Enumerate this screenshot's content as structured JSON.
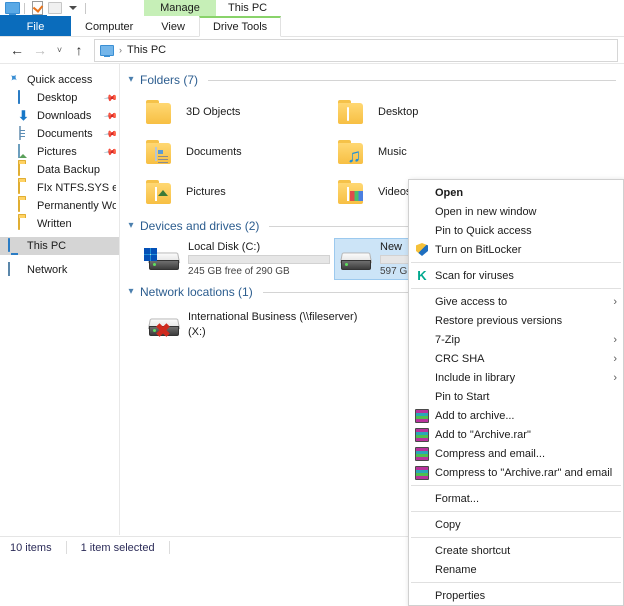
{
  "window": {
    "title": "This PC",
    "contextual_tab_header": "Manage",
    "quick_access_toolbar": [
      {
        "icon": "monitor-icon",
        "name": "this-pc-icon"
      },
      {
        "icon": "properties-icon",
        "name": "properties-icon"
      },
      {
        "icon": "new-folder-icon",
        "name": "new-folder-icon"
      },
      {
        "icon": "chevron-down-icon",
        "name": "customize-qat-icon"
      }
    ]
  },
  "ribbon": {
    "tabs": [
      {
        "label": "File",
        "state": "file"
      },
      {
        "label": "Computer",
        "state": "normal"
      },
      {
        "label": "View",
        "state": "normal"
      },
      {
        "label": "Drive Tools",
        "state": "active"
      }
    ]
  },
  "address_bar": {
    "back": "←",
    "forward": "→",
    "recent": "˅",
    "up": "↑",
    "separator": "›",
    "path": "This PC"
  },
  "sidebar": {
    "items": [
      {
        "label": "Quick access",
        "icon": "pin-star-icon",
        "indent": false,
        "pinned": false,
        "selected": false
      },
      {
        "label": "Desktop",
        "icon": "desktop-icon",
        "indent": true,
        "pinned": true,
        "selected": false
      },
      {
        "label": "Downloads",
        "icon": "downloads-icon",
        "indent": true,
        "pinned": true,
        "selected": false
      },
      {
        "label": "Documents",
        "icon": "documents-icon",
        "indent": true,
        "pinned": true,
        "selected": false
      },
      {
        "label": "Pictures",
        "icon": "pictures-icon",
        "indent": true,
        "pinned": true,
        "selected": false
      },
      {
        "label": "Data Backup",
        "icon": "folder-icon",
        "indent": true,
        "pinned": false,
        "selected": false
      },
      {
        "label": "FIx NTFS.SYS error",
        "icon": "folder-icon",
        "indent": true,
        "pinned": false,
        "selected": false
      },
      {
        "label": "Permanently Word",
        "icon": "folder-icon",
        "indent": true,
        "pinned": false,
        "selected": false
      },
      {
        "label": "Written",
        "icon": "folder-icon",
        "indent": true,
        "pinned": false,
        "selected": false
      },
      {
        "label": "This PC",
        "icon": "this-pc-icon",
        "indent": false,
        "pinned": false,
        "selected": true
      },
      {
        "label": "Network",
        "icon": "network-icon",
        "indent": false,
        "pinned": false,
        "selected": false
      }
    ]
  },
  "content": {
    "groups": {
      "folders": {
        "title": "Folders (7)",
        "items": [
          {
            "label": "3D Objects",
            "overlay": "3d-object-icon"
          },
          {
            "label": "Desktop",
            "overlay": "desktop-overlay-icon"
          },
          {
            "label": "Documents",
            "overlay": "documents-overlay-icon"
          },
          {
            "label": "Music",
            "overlay": "music-note-icon"
          },
          {
            "label": "Pictures",
            "overlay": "pictures-overlay-icon"
          },
          {
            "label": "Videos",
            "overlay": "videos-overlay-icon"
          }
        ]
      },
      "devices": {
        "title": "Devices and drives (2)",
        "items": [
          {
            "name": "Local Disk (C:)",
            "free_text": "245 GB free of 290 GB",
            "used_percent": 16,
            "selected": false,
            "icon": "local-disk-icon"
          },
          {
            "name": "New",
            "free_text": "597 G",
            "used_percent": 36,
            "selected": true,
            "icon": "drive-icon"
          }
        ]
      },
      "network": {
        "title": "Network locations (1)",
        "items": [
          {
            "label_line1": "International Business (\\\\fileserver)",
            "label_line2": "(X:)",
            "icon": "disconnected-network-drive-icon"
          }
        ]
      }
    }
  },
  "context_menu": {
    "items": [
      {
        "label": "Open",
        "icon": "",
        "arrow": false,
        "bold": true
      },
      {
        "label": "Open in new window",
        "icon": "",
        "arrow": false,
        "bold": false
      },
      {
        "label": "Pin to Quick access",
        "icon": "",
        "arrow": false,
        "bold": false
      },
      {
        "label": "Turn on BitLocker",
        "icon": "shield-icon",
        "arrow": false,
        "bold": false
      },
      {
        "separator": true
      },
      {
        "label": "Scan for viruses",
        "icon": "kaspersky-icon",
        "arrow": false,
        "bold": false
      },
      {
        "separator": true
      },
      {
        "label": "Give access to",
        "icon": "",
        "arrow": true,
        "bold": false
      },
      {
        "label": "Restore previous versions",
        "icon": "",
        "arrow": false,
        "bold": false
      },
      {
        "label": "7-Zip",
        "icon": "",
        "arrow": true,
        "bold": false
      },
      {
        "label": "CRC SHA",
        "icon": "",
        "arrow": true,
        "bold": false
      },
      {
        "label": "Include in library",
        "icon": "",
        "arrow": true,
        "bold": false
      },
      {
        "label": "Pin to Start",
        "icon": "",
        "arrow": false,
        "bold": false
      },
      {
        "label": "Add to archive...",
        "icon": "winrar-icon",
        "arrow": false,
        "bold": false
      },
      {
        "label": "Add to \"Archive.rar\"",
        "icon": "winrar-icon",
        "arrow": false,
        "bold": false
      },
      {
        "label": "Compress and email...",
        "icon": "winrar-icon",
        "arrow": false,
        "bold": false
      },
      {
        "label": "Compress to \"Archive.rar\" and email",
        "icon": "winrar-icon",
        "arrow": false,
        "bold": false
      },
      {
        "separator": true
      },
      {
        "label": "Format...",
        "icon": "",
        "arrow": false,
        "bold": false
      },
      {
        "separator": true
      },
      {
        "label": "Copy",
        "icon": "",
        "arrow": false,
        "bold": false
      },
      {
        "separator": true
      },
      {
        "label": "Create shortcut",
        "icon": "",
        "arrow": false,
        "bold": false
      },
      {
        "label": "Rename",
        "icon": "",
        "arrow": false,
        "bold": false
      },
      {
        "separator": true
      },
      {
        "label": "Properties",
        "icon": "",
        "arrow": false,
        "bold": false
      }
    ],
    "submenu_arrow": "›"
  },
  "status_bar": {
    "item_count": "10 items",
    "selection": "1 item selected"
  },
  "colors": {
    "accent": "#0a6cbc",
    "selection": "#cce4f7",
    "group_title": "#2c5d8f",
    "progress": "#2196e3",
    "contextual_tab": "#c6efb7"
  }
}
